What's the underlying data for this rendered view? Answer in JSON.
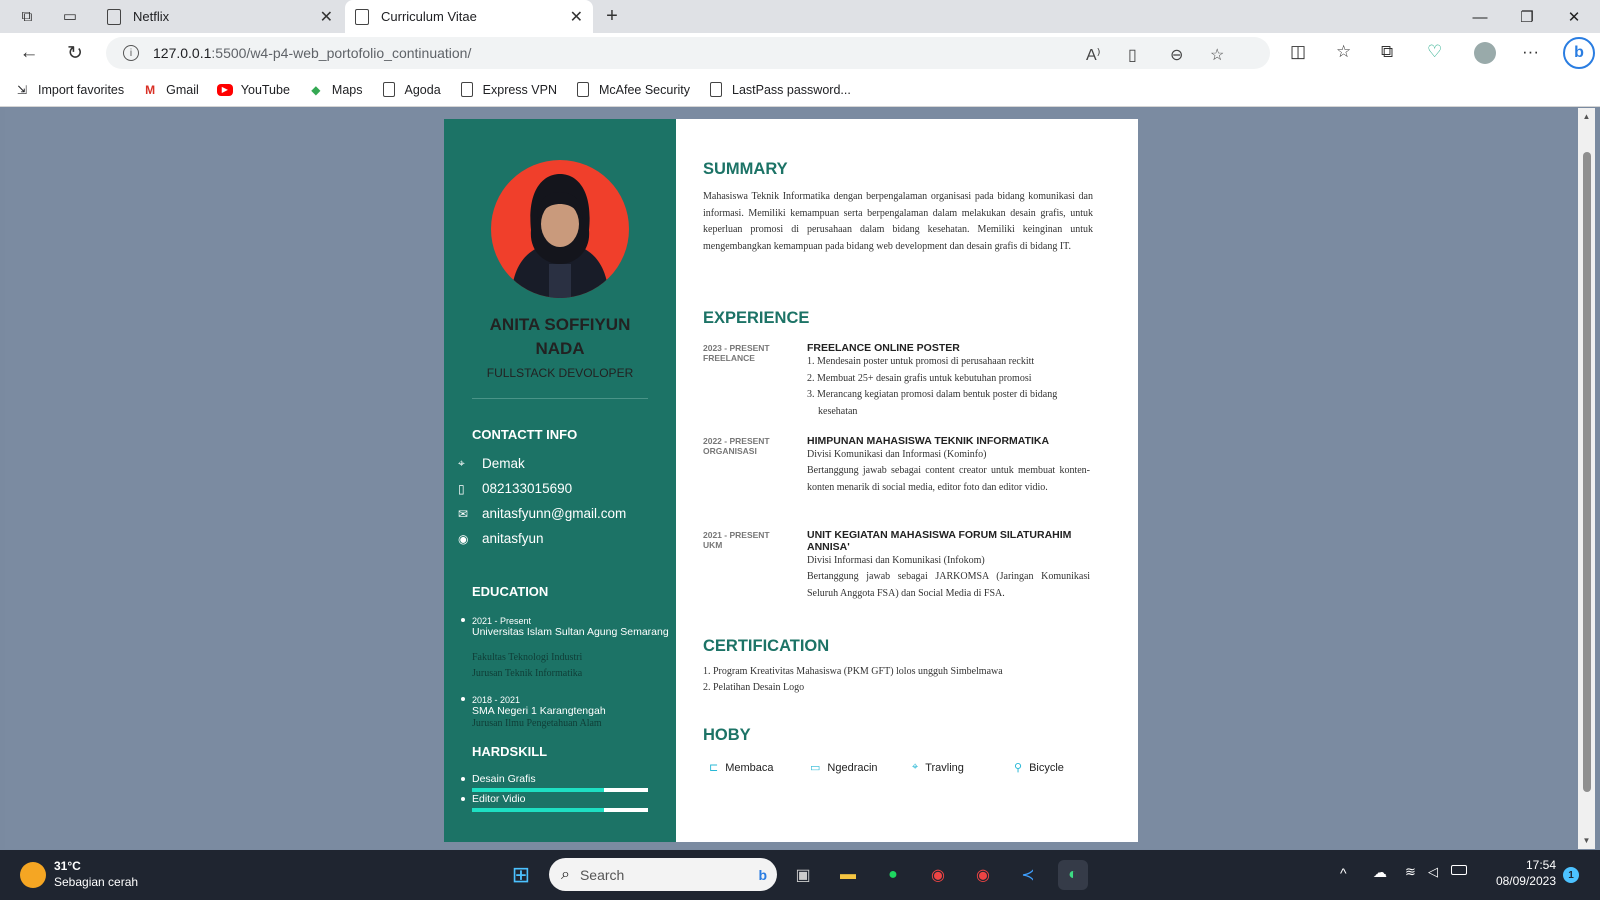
{
  "browser": {
    "tabs": [
      {
        "title": "Netflix"
      },
      {
        "title": "Curriculum Vitae"
      }
    ],
    "url_host": "127.0.0.1",
    "url_path": ":5500/w4-p4-web_portofolio_continuation/",
    "bookmarks": [
      "Import favorites",
      "Gmail",
      "YouTube",
      "Maps",
      "Agoda",
      "Express VPN",
      "McAfee Security",
      "LastPass password..."
    ]
  },
  "cv": {
    "name_line1": "ANITA SOFFIYUN",
    "name_line2": "NADA",
    "role": "FULLSTACK DEVOLOPER",
    "contact_heading": "CONTACTT INFO",
    "contacts": [
      {
        "icon": "location-icon",
        "text": "Demak"
      },
      {
        "icon": "phone-icon",
        "text": "082133015690"
      },
      {
        "icon": "mail-icon",
        "text": "anitasfyunn@gmail.com"
      },
      {
        "icon": "github-icon",
        "text": "anitasfyun"
      }
    ],
    "education_heading": "EDUCATION",
    "education": [
      {
        "years": "2021 - Present",
        "school": "Universitas Islam Sultan Agung Semarang",
        "detail1": "Fakultas Teknologi Industri",
        "detail2": "Jurusan Teknik Informatika"
      },
      {
        "years": "2018 - 2021",
        "school": "SMA Negeri 1 Karangtengah",
        "detail1": "Jurusan Ilmu Pengetahuan Alam"
      }
    ],
    "hardskill_heading": "HARDSKILL",
    "skills": [
      {
        "name": "Desain Grafis",
        "level": 0.75
      },
      {
        "name": "Editor Vidio",
        "level": 0.75
      }
    ],
    "summary_heading": "SUMMARY",
    "summary": "Mahasiswa Teknik Informatika dengan berpengalaman organisasi pada bidang komunikasi dan informasi. Memiliki kemampuan serta berpengalaman dalam melakukan desain grafis, untuk keperluan promosi di perusahaan dalam bidang kesehatan. Memiliki keinginan untuk mengembangkan kemampuan pada bidang web development dan desain grafis di bidang IT.",
    "experience_heading": "EXPERIENCE",
    "experience": [
      {
        "date": "2023 - PRESENT",
        "type": "FREELANCE",
        "title": "FREELANCE ONLINE POSTER",
        "items": [
          "1. Mendesain poster untuk promosi di perusahaan reckitt",
          "2. Membuat 25+ desain grafis untuk kebutuhan promosi",
          "3. Merancang kegiatan promosi dalam bentuk poster di bidang",
          "kesehatan"
        ]
      },
      {
        "date": "2022 - PRESENT",
        "type": "ORGANISASI",
        "title": "HIMPUNAN MAHASISWA TEKNIK INFORMATIKA",
        "sub": "Divisi Komunikasi dan Informasi (Kominfo)",
        "desc": "Bertanggung jawab sebagai content creator untuk membuat konten-konten menarik di social media, editor foto dan editor vidio."
      },
      {
        "date": "2021 - PRESENT",
        "type": "UKM",
        "title": "UNIT KEGIATAN MAHASISWA FORUM SILATURAHIM ANNISA'",
        "sub": "Divisi Informasi dan Komunikasi (Infokom)",
        "desc": "Bertanggung jawab sebagai JARKOMSA (Jaringan Komunikasi Seluruh Anggota FSA) dan Social Media di FSA."
      }
    ],
    "certification_heading": "CERTIFICATION",
    "certifications": [
      "1. Program Kreativitas Mahasiswa (PKM GFT) lolos ungguh Simbelmawa",
      "2. Pelatihan Desain Logo"
    ],
    "hoby_heading": "HOBY",
    "hobbies": [
      {
        "icon": "book-icon",
        "label": "Membaca"
      },
      {
        "icon": "laptop-icon",
        "label": "Ngedracin"
      },
      {
        "icon": "map-pin-icon",
        "label": "Travling"
      },
      {
        "icon": "bicycle-icon",
        "label": "Bicycle"
      }
    ]
  },
  "taskbar": {
    "temperature": "31°C",
    "weather": "Sebagian cerah",
    "search_placeholder": "Search",
    "time": "17:54",
    "date": "08/09/2023",
    "notification_count": "1"
  },
  "colors": {
    "sidebar": "#1c7366",
    "accent": "#1ee0c3",
    "photo_bg": "#f03f2b"
  }
}
